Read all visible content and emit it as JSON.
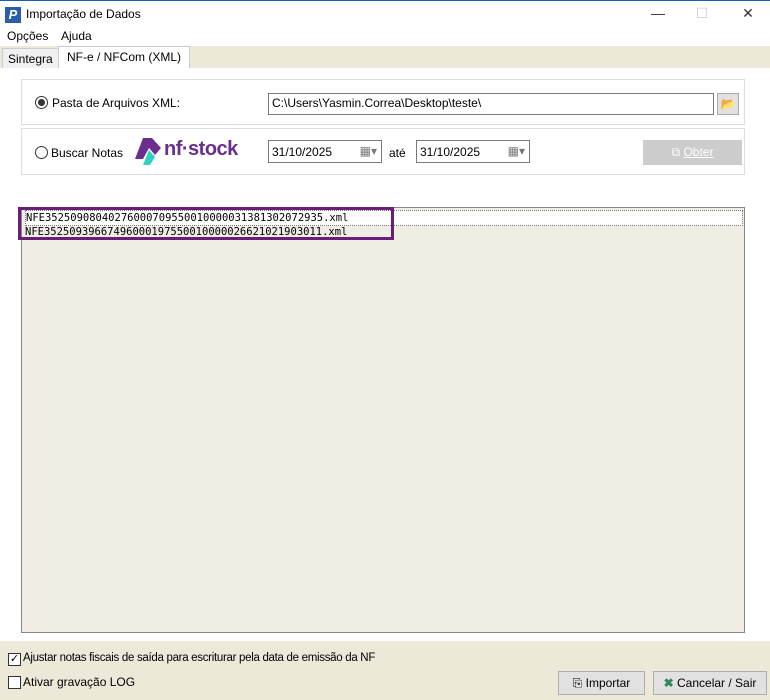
{
  "window": {
    "title": "Importação de Dados",
    "minimize": "—",
    "maximize": "☐",
    "close": "✕"
  },
  "menu": [
    "Opções",
    "Ajuda"
  ],
  "tabs": [
    {
      "label": "Sintegra"
    },
    {
      "label": "NF-e / NFCom (XML)"
    }
  ],
  "folder": {
    "label": "Pasta de Arquivos XML:",
    "value": "C:\\Users\\Yasmin.Correa\\Desktop\\teste\\",
    "selected": true
  },
  "search": {
    "label": "Buscar Notas",
    "logo": "nf·stock",
    "date_from": "31/10/2025",
    "until_label": "até",
    "date_to": "31/10/2025",
    "fetch_label": "Obter",
    "selected": false
  },
  "files": [
    "NFE35250908040276000709550010000031381302072935.xml",
    "NFE35250939667496000197550010000026621021903011.xml"
  ],
  "options": {
    "adjust_label": "Ajustar notas fiscais de saída para escriturar pela data de emissão da NF",
    "adjust_checked": true,
    "log_label": "Ativar gravação LOG",
    "log_checked": false
  },
  "buttons": {
    "import": "Importar",
    "cancel": "Cancelar / Sair"
  }
}
